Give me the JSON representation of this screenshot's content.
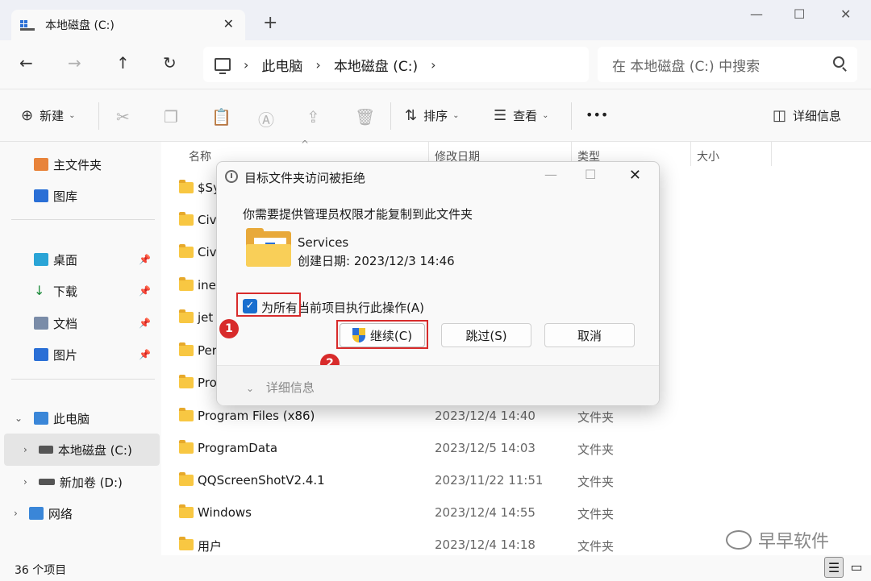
{
  "window": {
    "tab_title": "本地磁盘 (C:)",
    "tab_close": "✕",
    "new_tab": "+",
    "minimize": "—",
    "maximize": "☐",
    "close": "✕"
  },
  "nav": {
    "back": "←",
    "forward": "→",
    "up": "↑",
    "refresh": "↻",
    "breadcrumb": [
      "此电脑",
      "本地磁盘 (C:)"
    ],
    "separator": "›",
    "search_placeholder": "在 本地磁盘 (C:) 中搜索"
  },
  "toolbar": {
    "new_label": "新建",
    "sort_label": "排序",
    "view_label": "查看",
    "more_label": "•••",
    "details_label": "详细信息"
  },
  "sidebar": {
    "items": [
      {
        "label": "主文件夹"
      },
      {
        "label": "图库"
      },
      {
        "label": "桌面"
      },
      {
        "label": "下载"
      },
      {
        "label": "文档"
      },
      {
        "label": "图片"
      },
      {
        "label": "此电脑"
      },
      {
        "label": "本地磁盘 (C:)"
      },
      {
        "label": "新加卷 (D:)"
      },
      {
        "label": "网络"
      }
    ],
    "pin": "📌"
  },
  "columns": {
    "name": "名称",
    "modified": "修改日期",
    "type": "类型",
    "size": "大小"
  },
  "files": [
    {
      "name": "$Sy",
      "date": "",
      "type": ""
    },
    {
      "name": "Civ",
      "date": "",
      "type": ""
    },
    {
      "name": "Civ",
      "date": "",
      "type": ""
    },
    {
      "name": "ine",
      "date": "",
      "type": ""
    },
    {
      "name": "jet",
      "date": "",
      "type": ""
    },
    {
      "name": "Per",
      "date": "",
      "type": ""
    },
    {
      "name": "Pro",
      "date": "",
      "type": ""
    },
    {
      "name": "Program Files (x86)",
      "date": "2023/12/4 14:40",
      "type": "文件夹"
    },
    {
      "name": "ProgramData",
      "date": "2023/12/5 14:03",
      "type": "文件夹"
    },
    {
      "name": "QQScreenShotV2.4.1",
      "date": "2023/11/22 11:51",
      "type": "文件夹"
    },
    {
      "name": "Windows",
      "date": "2023/12/4 14:55",
      "type": "文件夹"
    },
    {
      "name": "用户",
      "date": "2023/12/4 14:18",
      "type": "文件夹"
    }
  ],
  "status": {
    "count": "36 个项目"
  },
  "watermark": "早早软件",
  "dialog": {
    "title": "目标文件夹访问被拒绝",
    "message": "你需要提供管理员权限才能复制到此文件夹",
    "folder_name": "Services",
    "folder_created": "创建日期: 2023/12/3 14:46",
    "checkbox_label": "为所有当前项目执行此操作(A)",
    "checkbox_mark": "✓",
    "continue_label": "继续(C)",
    "skip_label": "跳过(S)",
    "cancel_label": "取消",
    "details_label": "详细信息",
    "badge1": "1",
    "badge2": "2"
  },
  "colors": {
    "highlight": "#d82b2b",
    "checkbox": "#1a6fcf",
    "folder": "#f8c742"
  }
}
